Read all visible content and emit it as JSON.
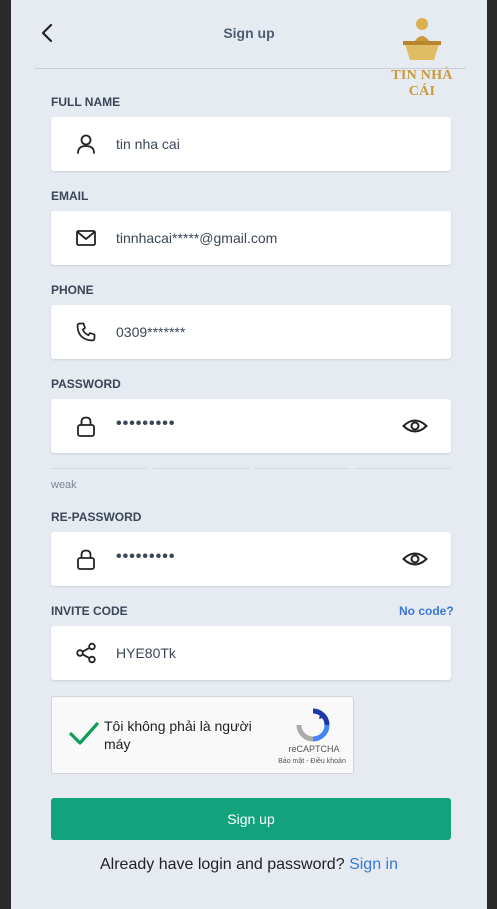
{
  "header": {
    "title": "Sign up",
    "logo_text": "TIN NHÀ CÁI"
  },
  "fields": {
    "full_name": {
      "label": "FULL NAME",
      "value": "tin nha cai"
    },
    "email": {
      "label": "EMAIL",
      "value": "tinnhacai*****@gmail.com"
    },
    "phone": {
      "label": "PHONE",
      "value": "0309*******"
    },
    "password": {
      "label": "PASSWORD",
      "value": "•••••••••",
      "strength": "weak"
    },
    "re_password": {
      "label": "RE-PASSWORD",
      "value": "•••••••••"
    },
    "invite_code": {
      "label": "INVITE CODE",
      "value": "HYE80Tk",
      "no_code_link": "No code?"
    }
  },
  "captcha": {
    "text": "Tôi không phải là người máy",
    "brand": "reCAPTCHA",
    "links": "Bảo mật - Điều khoản"
  },
  "submit": {
    "label": "Sign up"
  },
  "footer": {
    "prompt": "Already have login and password?",
    "link": "Sign in"
  },
  "colors": {
    "accent": "#12a37d",
    "link": "#3a78d8",
    "background": "#e6ebf2"
  }
}
